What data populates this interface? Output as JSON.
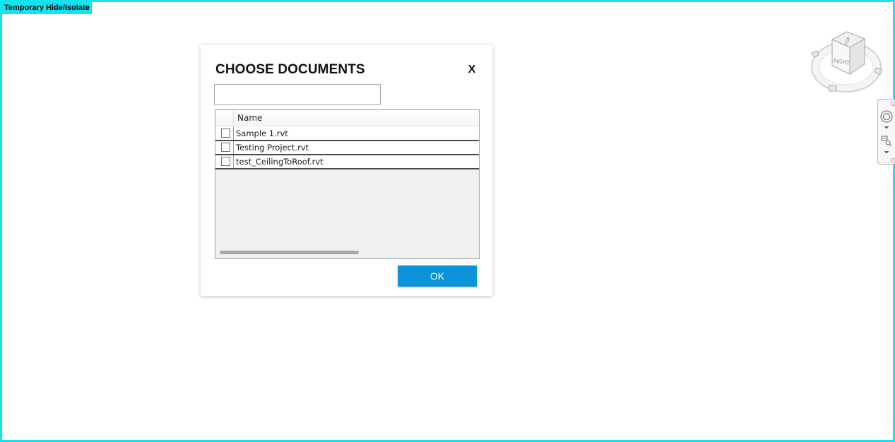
{
  "viewport": {
    "mode_label": "Temporary Hide/Isolate",
    "border_color": "#14e2ee"
  },
  "dialog": {
    "title": "CHOOSE DOCUMENTS",
    "close_label": "X",
    "search": {
      "value": "",
      "placeholder": ""
    },
    "list": {
      "column_header": "Name",
      "documents": [
        {
          "name": "Sample 1.rvt",
          "checked": false
        },
        {
          "name": "Testing Project.rvt",
          "checked": false
        },
        {
          "name": "test_CeilingToRoof.rvt",
          "checked": false
        }
      ]
    },
    "ok_label": "OK",
    "ok_color": "#0c92d8"
  },
  "viewcube": {
    "top_face": "TOP",
    "right_face": "RIGHT"
  },
  "icons": {
    "viewcube": "viewcube-icon",
    "steering_wheel": "steering-wheel-icon",
    "zoom": "zoom-region-icon",
    "dropdown": "chevron-down-icon"
  }
}
